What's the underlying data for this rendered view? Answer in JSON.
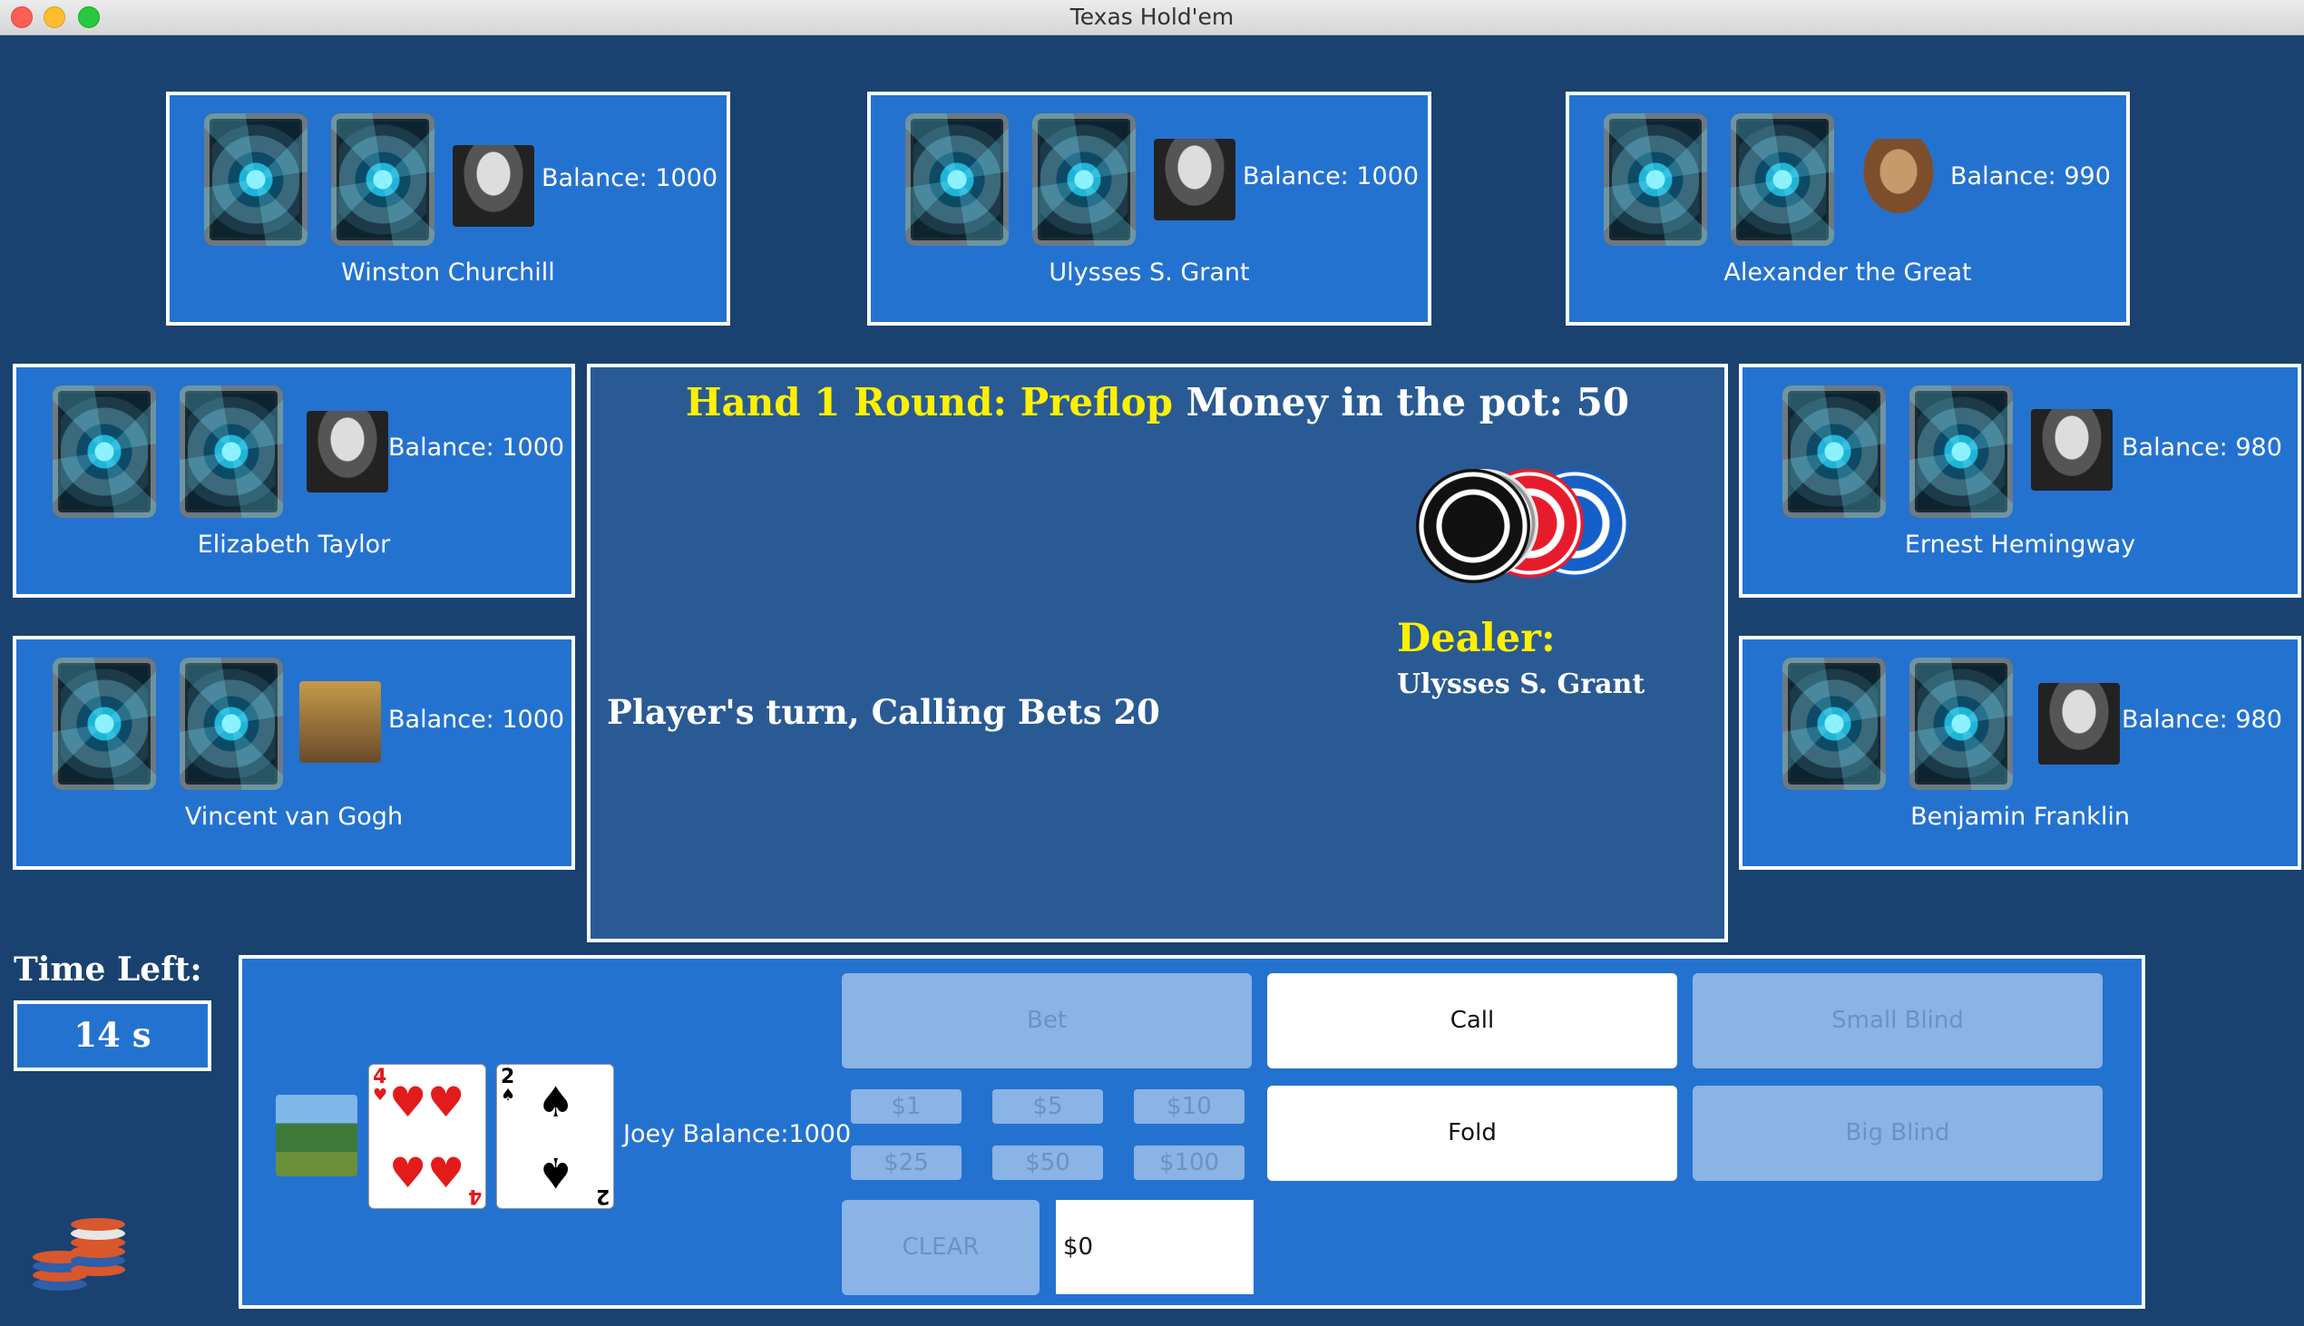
{
  "window": {
    "title": "Texas Hold'em"
  },
  "players": [
    {
      "name": "Winston Churchill",
      "balance": "Balance: 1000"
    },
    {
      "name": "Ulysses S. Grant",
      "balance": "Balance: 1000"
    },
    {
      "name": "Alexander the Great",
      "balance": "Balance: 990"
    },
    {
      "name": "Elizabeth Taylor",
      "balance": "Balance: 1000"
    },
    {
      "name": "Ernest Hemingway",
      "balance": "Balance: 980"
    },
    {
      "name": "Vincent van Gogh",
      "balance": "Balance: 1000"
    },
    {
      "name": "Benjamin Franklin",
      "balance": "Balance: 980"
    }
  ],
  "table": {
    "hand_round": "Hand 1 Round: Preflop",
    "pot": "Money in the pot: 50",
    "turn_status": "Player's turn, Calling Bets 20",
    "dealer_label": "Dealer:",
    "dealer_name": "Ulysses S. Grant"
  },
  "timer": {
    "label": "Time Left:",
    "value": "14 s"
  },
  "me": {
    "name": "Joey",
    "balance": "Balance:1000",
    "cards": [
      {
        "rank": "4",
        "suit": "♥"
      },
      {
        "rank": "2",
        "suit": "♠"
      }
    ]
  },
  "controls": {
    "bet": "Bet",
    "call": "Call",
    "small_blind": "Small Blind",
    "fold": "Fold",
    "big_blind": "Big Blind",
    "clear": "CLEAR",
    "amounts": [
      "$1",
      "$5",
      "$10",
      "$25",
      "$50",
      "$100"
    ],
    "bet_value": "$0"
  },
  "colors": {
    "accent_yellow": "#fff000",
    "panel_blue": "#2472d0",
    "background": "#1a4270"
  }
}
